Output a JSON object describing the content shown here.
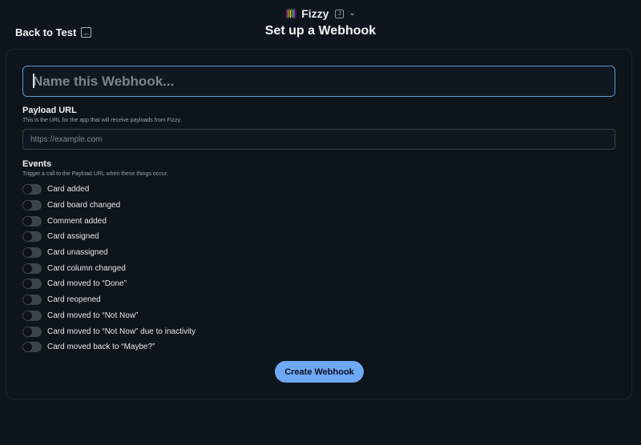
{
  "app": {
    "name": "Fizzy",
    "logo_colors": [
      "#e84a5f",
      "#f5a623",
      "#f8e71c",
      "#7ed321",
      "#4a90e2",
      "#bd10e0"
    ]
  },
  "nav": {
    "back_label": "Back to Test",
    "back_icon": "arrow-left-icon"
  },
  "page": {
    "title": "Set up a Webhook"
  },
  "form": {
    "name_placeholder": "Name this Webhook...",
    "name_value": "",
    "payload_label": "Payload URL",
    "payload_help": "This is the URL for the app that will receive payloads from Fizzy.",
    "payload_placeholder": "https://example.com",
    "payload_value": "",
    "events_label": "Events",
    "events_help": "Trigger a call to the Payload URL when these things occur:",
    "events": [
      {
        "label": "Card added",
        "enabled": false
      },
      {
        "label": "Card board changed",
        "enabled": false
      },
      {
        "label": "Comment added",
        "enabled": false
      },
      {
        "label": "Card assigned",
        "enabled": false
      },
      {
        "label": "Card unassigned",
        "enabled": false
      },
      {
        "label": "Card column changed",
        "enabled": false
      },
      {
        "label": "Card moved to “Done”",
        "enabled": false
      },
      {
        "label": "Card reopened",
        "enabled": false
      },
      {
        "label": "Card moved to “Not Now”",
        "enabled": false
      },
      {
        "label": "Card moved to “Not Now” due to inactivity",
        "enabled": false
      },
      {
        "label": "Card moved back to “Maybe?”",
        "enabled": false
      }
    ],
    "submit_label": "Create Webhook"
  },
  "colors": {
    "background": "#0e151c",
    "accent": "#6fa8f5",
    "focus_border": "#5a9bd6"
  }
}
